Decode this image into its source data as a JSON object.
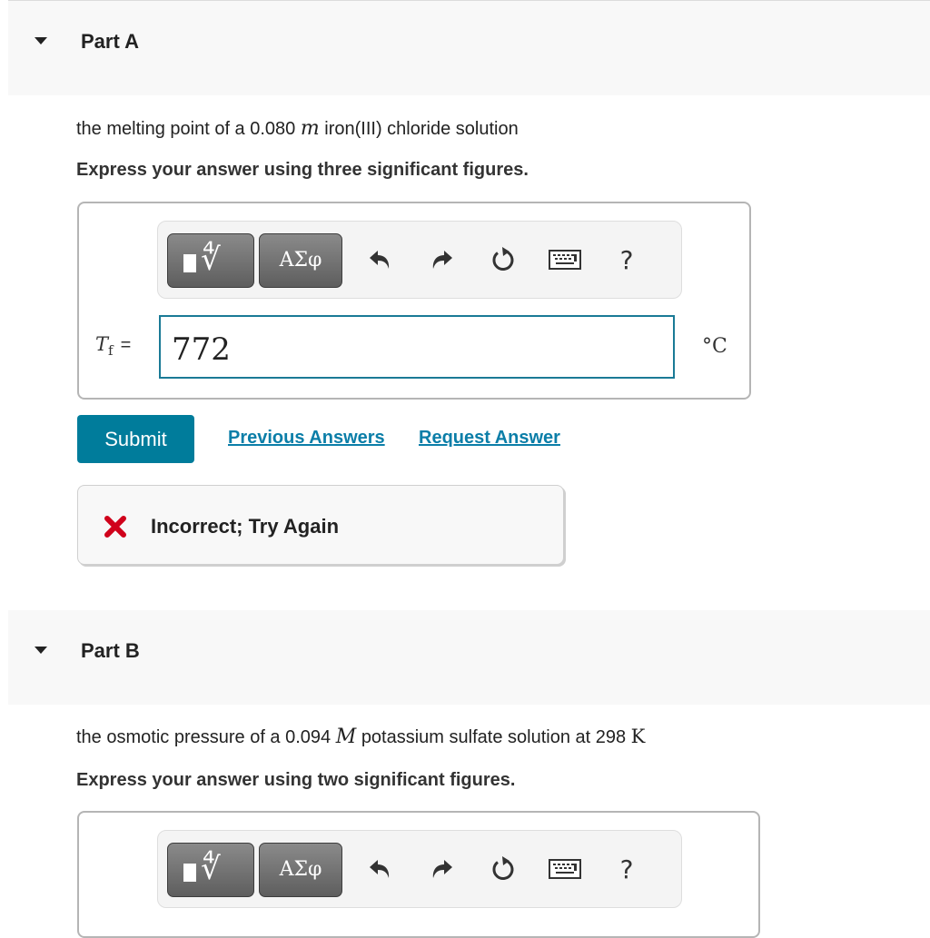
{
  "parts": [
    {
      "id": "A",
      "header": {
        "title": "Part A",
        "caret_icon": "caret-down-icon"
      },
      "question": {
        "prefix": "the melting point of a 0.080",
        "unit_symbol": "m",
        "suffix": "iron(III) chloride solution"
      },
      "instruction": "Express your answer using three significant figures.",
      "toolbar": {
        "templates_button": "templates-radical-icon",
        "symbols_label": "ΑΣφ",
        "undo_icon": "undo-icon",
        "redo_icon": "redo-icon",
        "reset_icon": "reset-icon",
        "keyboard_icon": "keyboard-icon",
        "help_label": "?"
      },
      "answer": {
        "variable": "T",
        "variable_sub": "f",
        "equals": "=",
        "value": "772",
        "unit": "°C"
      },
      "actions": {
        "submit_label": "Submit",
        "previous_answers_label": "Previous Answers",
        "request_answer_label": "Request Answer"
      },
      "feedback": {
        "status": "incorrect",
        "icon": "red-x-icon",
        "message": "Incorrect; Try Again",
        "color": "#d0021b"
      }
    },
    {
      "id": "B",
      "header": {
        "title": "Part B",
        "caret_icon": "caret-down-icon"
      },
      "question": {
        "prefix": "the osmotic pressure of a 0.094",
        "unit_symbol": "M",
        "middle": "potassium sulfate solution at 298",
        "suffix_unit": "K"
      },
      "instruction": "Express your answer using two significant figures.",
      "toolbar": {
        "templates_button": "templates-radical-icon",
        "symbols_label": "ΑΣφ",
        "undo_icon": "undo-icon",
        "redo_icon": "redo-icon",
        "reset_icon": "reset-icon",
        "keyboard_icon": "keyboard-icon",
        "help_label": "?"
      }
    }
  ],
  "colors": {
    "accent": "#007c9b",
    "link": "#0b7ea8",
    "input_border": "#1a7a96",
    "header_bg": "#f8f8f8",
    "error": "#d0021b"
  }
}
